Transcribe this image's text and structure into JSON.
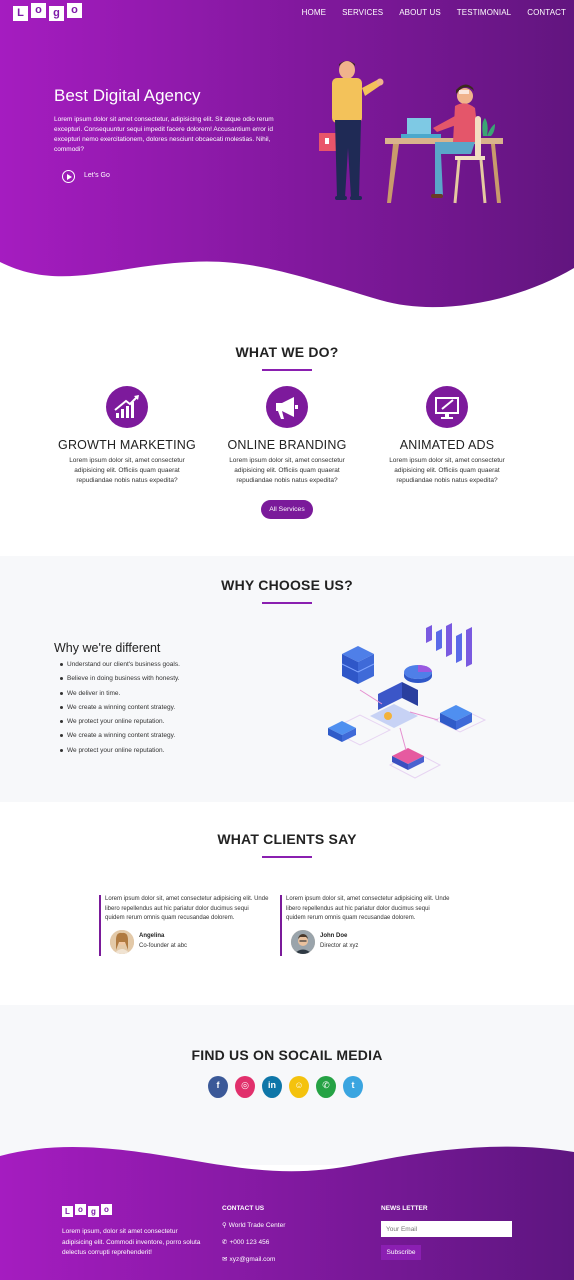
{
  "colors": {
    "brand_purple": "#8a1fb0",
    "brand_purple_dark": "#5c1785",
    "hero_gradient_start": "#9b1ab8",
    "hero_gradient_end": "#62157f",
    "section_grey": "#f7f8fa"
  },
  "nav": {
    "logo_letters": [
      "L",
      "o",
      "g",
      "o"
    ],
    "menu": [
      "HOME",
      "SERVICES",
      "ABOUT US",
      "TESTIMONIAL",
      "CONTACT"
    ]
  },
  "hero": {
    "title": "Best Digital Agency",
    "text": "Lorem ipsum dolor sit amet consectetur, adipisicing elit. Sit atque odio rerum excepturi. Consequuntur sequi impedit facere dolorem! Accusantium error id excepturi nemo exercitationem, dolores nesciunt obcaecati molestias. Nihil, commodi?",
    "cta_label": "Let's Go",
    "cta_icon": "play-circle-icon"
  },
  "what_we_do": {
    "title": "WHAT WE DO?",
    "services": [
      {
        "icon": "growth-chart-icon",
        "title": "GROWTH MARKETING",
        "text": "Lorem ipsum dolor sit, amet consectetur adipisicing elit. Officiis quam quaerat repudiandae nobis natus expedita?"
      },
      {
        "icon": "megaphone-icon",
        "title": "ONLINE BRANDING",
        "text": "Lorem ipsum dolor sit, amet consectetur adipisicing elit. Officiis quam quaerat repudiandae nobis natus expedita?"
      },
      {
        "icon": "monitor-pen-icon",
        "title": "ANIMATED ADS",
        "text": "Lorem ipsum dolor sit, amet consectetur adipisicing elit. Officiis quam quaerat repudiandae nobis natus expedita?"
      }
    ],
    "button_label": "All Services"
  },
  "why_choose": {
    "title": "WHY CHOOSE US?",
    "subtitle": "Why we're different",
    "items": [
      "Understand our client's business goals.",
      "Believe in doing business with honesty.",
      "We deliver in time.",
      "We create a winning content strategy.",
      "We protect your online reputation.",
      "We create a winning content strategy.",
      "We protect your online reputation."
    ]
  },
  "clients": {
    "title": "WHAT CLIENTS SAY",
    "testimonials": [
      {
        "text": "Lorem ipsum dolor sit, amet consectetur adipisicing elit. Unde libero repellendus aut hic pariatur dolor ducimus sequi quidem rerum omnis quam recusandae dolorem.",
        "name": "Angelina",
        "role": "Co-founder at abc"
      },
      {
        "text": "Lorem ipsum dolor sit, amet consectetur adipisicing elit. Unde libero repellendus aut hic pariatur dolor ducimus sequi quidem rerum omnis quam recusandae dolorem.",
        "name": "John Doe",
        "role": "Director at xyz"
      }
    ]
  },
  "social": {
    "title": "FIND US ON SOCAIL MEDIA",
    "icons": [
      {
        "icon": "facebook-icon",
        "glyph": "f",
        "color": "#3b5998"
      },
      {
        "icon": "instagram-icon",
        "glyph": "◎",
        "color": "#e1306c"
      },
      {
        "icon": "linkedin-icon",
        "glyph": "in",
        "color": "#0e76a8"
      },
      {
        "icon": "snapchat-icon",
        "glyph": "☺",
        "color": "#f4c20d"
      },
      {
        "icon": "whatsapp-icon",
        "glyph": "✆",
        "color": "#25a244"
      },
      {
        "icon": "twitter-icon",
        "glyph": "t",
        "color": "#3aa5e0"
      }
    ]
  },
  "footer": {
    "logo_letters": [
      "L",
      "o",
      "g",
      "o"
    ],
    "about": "Lorem ipsum, dolor sit amet consectetur adipisicing elit. Commodi inventore, porro soluta delectus corrupti reprehenderit!",
    "contact_title": "CONTACT US",
    "address": "World Trade Center",
    "phone": "+000 123 456",
    "email": "xyz@gmail.com",
    "newsletter_title": "NEWS LETTER",
    "email_placeholder": "Your Email",
    "subscribe_label": "Subscribe"
  }
}
